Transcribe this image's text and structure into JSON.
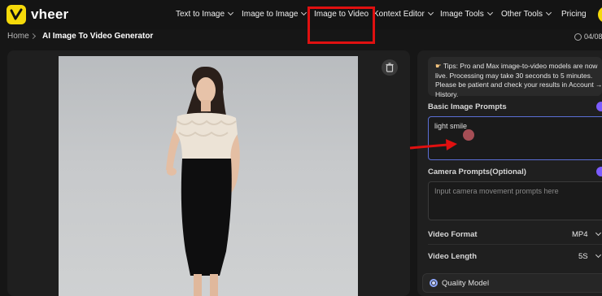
{
  "brand": {
    "name": "vheer",
    "accent": "#f5d90a"
  },
  "nav": {
    "items": [
      {
        "label": "Text to Image",
        "dropdown": true
      },
      {
        "label": "Image to Image",
        "dropdown": true
      },
      {
        "label": "Image to Video",
        "dropdown": false
      },
      {
        "label": "Kontext Editor",
        "dropdown": true
      },
      {
        "label": "Image Tools",
        "dropdown": true
      },
      {
        "label": "Other Tools",
        "dropdown": true
      },
      {
        "label": "Pricing",
        "dropdown": false
      }
    ]
  },
  "breadcrumb": {
    "home": "Home",
    "current": "AI Image To Video Generator"
  },
  "credits": {
    "text": "04/08"
  },
  "tips": {
    "icon": "pointing-hand-icon",
    "text": "Tips: Pro and Max image-to-video models are now live. Processing may take 30 seconds to 5 minutes. Please be patient and check your results in Account → History."
  },
  "form": {
    "basic_prompt_label": "Basic Image Prompts",
    "basic_prompt_value": "light smile",
    "camera_prompt_label": "Camera Prompts(Optional)",
    "camera_prompt_placeholder": "Input camera movement prompts here",
    "video_format_label": "Video Format",
    "video_format_value": "MP4",
    "video_length_label": "Video Length",
    "video_length_value": "5S",
    "quality_label": "Quality Model"
  },
  "annotation_colors": {
    "highlight": "#e01010",
    "arrow": "#e01010",
    "focus": "#5b6fd6"
  }
}
